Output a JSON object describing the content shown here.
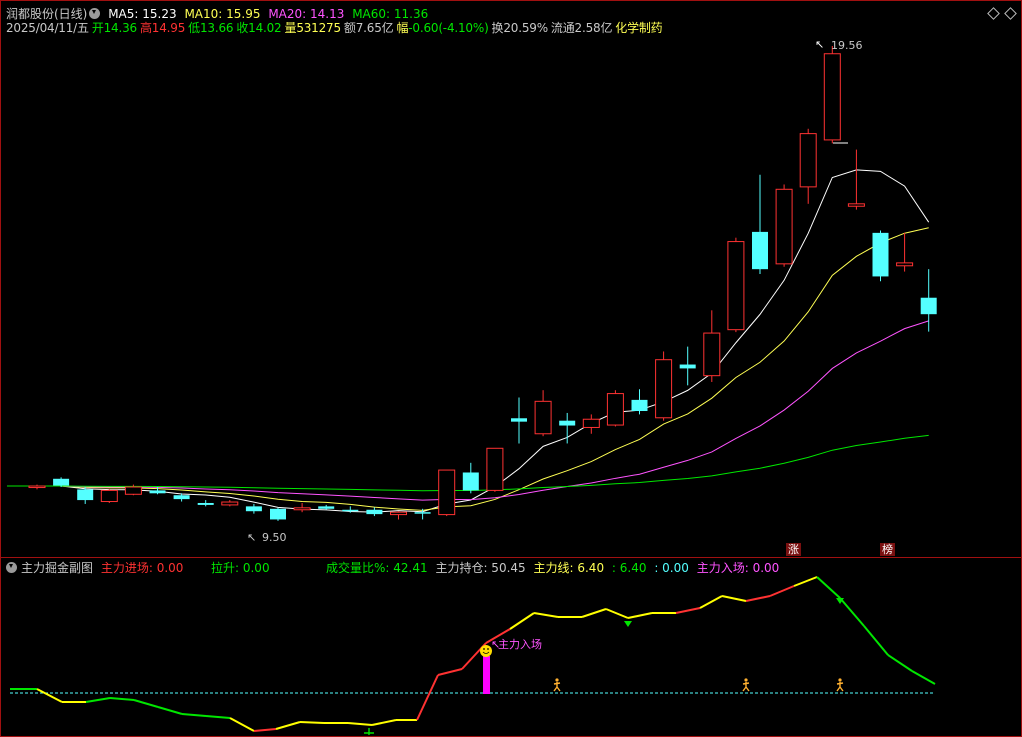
{
  "main_header": {
    "title": "润都股份(日线)",
    "ma5": "MA5: 15.23",
    "ma10": "MA10: 15.95",
    "ma20": "MA20: 14.13",
    "ma60": "MA60: 11.36"
  },
  "info_line": {
    "date": "2025/04/11/五",
    "open_label": "开",
    "open": "14.36",
    "high_label": "高",
    "high": "14.95",
    "low_label": "低",
    "low": "13.66",
    "close_label": "收",
    "close": "14.02",
    "volume_label": "量",
    "volume": "531275",
    "amount_label": "额",
    "amount": "7.65亿",
    "change_label": "幅",
    "change": "-0.60(-4.10%)",
    "turnover_label": "换",
    "turnover": "20.59%",
    "float_label": "流通",
    "float": "2.58亿",
    "sector": "化学制药"
  },
  "sub_header": {
    "title": "主力掘金副图",
    "entry": "主力进场: 0.00",
    "lift": "拉升: 0.00",
    "vol_ratio": "成交量比%: 42.41",
    "holding": "主力持仓: 50.45",
    "line_label": "主力线: ",
    "line_val1": "6.40",
    "line_val2": ": 6.40",
    "line_val3": ": 0.00",
    "inflow": "主力入场: 0.00"
  },
  "annotations": {
    "high_mark": "19.56",
    "low_mark": "9.50",
    "marker_zhang": "涨",
    "marker_bang": "榜",
    "entry_label": "主力入场"
  },
  "colors": {
    "up": "#ff3232",
    "down": "#54ffff",
    "ma5": "#ffffff",
    "ma10": "#ffff54",
    "ma20": "#ff54ff",
    "ma60": "#00e600"
  },
  "chart_data": {
    "type": "candlestick",
    "price_marks": {
      "high": 19.56,
      "low": 9.5
    },
    "candles": [
      {
        "o": 10.45,
        "h": 10.5,
        "l": 10.4,
        "c": 10.47
      },
      {
        "o": 10.62,
        "h": 10.65,
        "l": 10.45,
        "c": 10.48
      },
      {
        "o": 10.4,
        "h": 10.45,
        "l": 10.1,
        "c": 10.18
      },
      {
        "o": 10.15,
        "h": 10.4,
        "l": 10.12,
        "c": 10.38
      },
      {
        "o": 10.3,
        "h": 10.5,
        "l": 10.28,
        "c": 10.45
      },
      {
        "o": 10.38,
        "h": 10.45,
        "l": 10.3,
        "c": 10.32
      },
      {
        "o": 10.28,
        "h": 10.32,
        "l": 10.15,
        "c": 10.2
      },
      {
        "o": 10.12,
        "h": 10.18,
        "l": 10.05,
        "c": 10.08
      },
      {
        "o": 10.08,
        "h": 10.18,
        "l": 10.05,
        "c": 10.14
      },
      {
        "o": 10.05,
        "h": 10.1,
        "l": 9.9,
        "c": 9.95
      },
      {
        "o": 10.0,
        "h": 10.02,
        "l": 9.75,
        "c": 9.78
      },
      {
        "o": 9.98,
        "h": 10.12,
        "l": 9.93,
        "c": 10.02
      },
      {
        "o": 10.05,
        "h": 10.08,
        "l": 9.98,
        "c": 10.0
      },
      {
        "o": 9.98,
        "h": 10.05,
        "l": 9.92,
        "c": 9.97
      },
      {
        "o": 9.98,
        "h": 10.03,
        "l": 9.85,
        "c": 9.89
      },
      {
        "o": 9.88,
        "h": 9.95,
        "l": 9.78,
        "c": 9.93
      },
      {
        "o": 9.93,
        "h": 10.0,
        "l": 9.78,
        "c": 9.91
      },
      {
        "o": 9.88,
        "h": 10.8,
        "l": 9.85,
        "c": 10.8
      },
      {
        "o": 10.75,
        "h": 10.95,
        "l": 10.32,
        "c": 10.38
      },
      {
        "o": 10.38,
        "h": 11.25,
        "l": 10.35,
        "c": 11.25
      },
      {
        "o": 11.87,
        "h": 12.3,
        "l": 11.35,
        "c": 11.8
      },
      {
        "o": 11.55,
        "h": 12.45,
        "l": 11.5,
        "c": 12.22
      },
      {
        "o": 11.82,
        "h": 11.98,
        "l": 11.35,
        "c": 11.72
      },
      {
        "o": 11.68,
        "h": 11.95,
        "l": 11.55,
        "c": 11.85
      },
      {
        "o": 11.73,
        "h": 12.45,
        "l": 11.7,
        "c": 12.38
      },
      {
        "o": 12.25,
        "h": 12.47,
        "l": 11.95,
        "c": 12.02
      },
      {
        "o": 11.88,
        "h": 13.25,
        "l": 11.82,
        "c": 13.08
      },
      {
        "o": 12.98,
        "h": 13.35,
        "l": 12.55,
        "c": 12.9
      },
      {
        "o": 12.75,
        "h": 14.1,
        "l": 12.62,
        "c": 13.63
      },
      {
        "o": 13.7,
        "h": 15.6,
        "l": 13.65,
        "c": 15.52
      },
      {
        "o": 15.72,
        "h": 16.9,
        "l": 14.85,
        "c": 14.95
      },
      {
        "o": 15.06,
        "h": 16.7,
        "l": 15.0,
        "c": 16.6
      },
      {
        "o": 16.65,
        "h": 17.85,
        "l": 16.3,
        "c": 17.75
      },
      {
        "o": 17.62,
        "h": 19.56,
        "l": 17.55,
        "c": 19.4
      },
      {
        "o": 16.25,
        "h": 17.42,
        "l": 16.18,
        "c": 16.3
      },
      {
        "o": 15.7,
        "h": 15.75,
        "l": 14.7,
        "c": 14.8
      },
      {
        "o": 15.02,
        "h": 15.7,
        "l": 14.9,
        "c": 15.08
      },
      {
        "o": 14.36,
        "h": 14.95,
        "l": 13.66,
        "c": 14.02
      }
    ]
  }
}
